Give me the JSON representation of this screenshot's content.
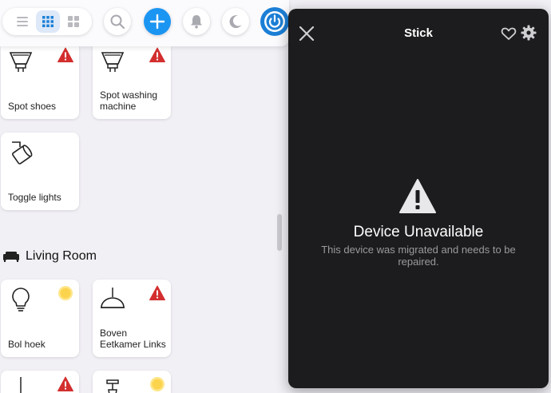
{
  "toolbar": {
    "view_modes": [
      "list-view",
      "grid-view",
      "compact-grid-view"
    ],
    "active_view": "grid-view"
  },
  "tiles": [
    {
      "name": "Spot shoes",
      "icon": "spot-light-icon",
      "status": "warning"
    },
    {
      "name": "Spot washing machine",
      "icon": "spot-light-icon",
      "status": "warning"
    },
    {
      "name": "Toggle lights",
      "icon": "rotating-spot-icon",
      "status": "none"
    },
    {
      "name": "Bol hoek",
      "icon": "bulb-icon",
      "status": "on"
    },
    {
      "name": "Boven Eetkamer Links",
      "icon": "pendant-lamp-icon",
      "status": "warning"
    }
  ],
  "section": {
    "title": "Living Room",
    "icon": "sofa-icon"
  },
  "panel": {
    "title": "Stick",
    "state": "Device Unavailable",
    "description": "This device was migrated and needs to be repaired."
  },
  "colors": {
    "accent": "#1b95f2",
    "warning": "#d32f2f",
    "on": "#fde68a",
    "panel_bg": "#1c1c1e"
  }
}
